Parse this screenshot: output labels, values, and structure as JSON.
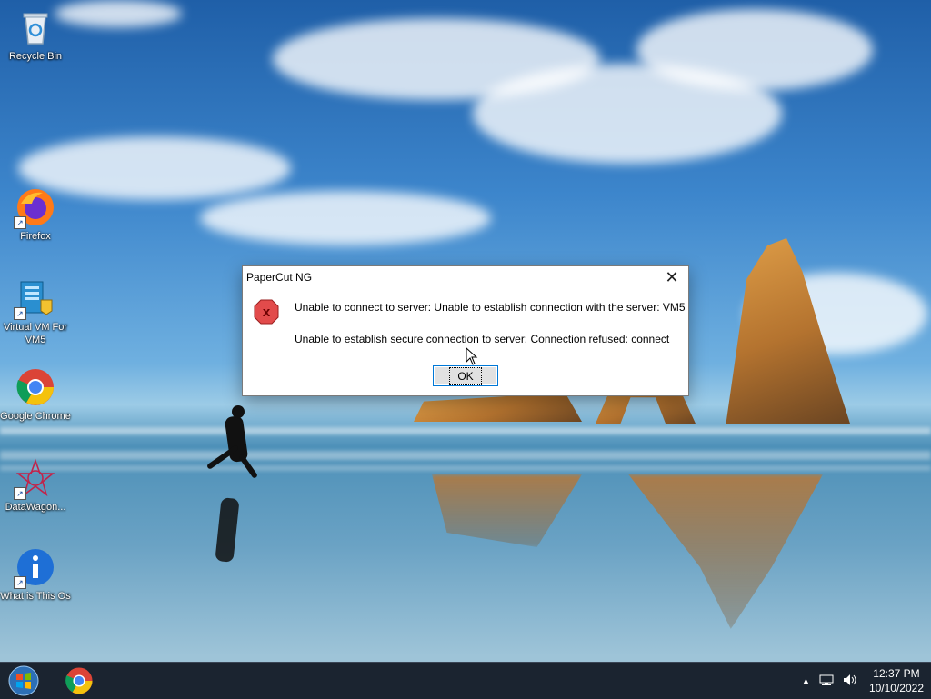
{
  "desktop": {
    "icons": [
      {
        "label": "Recycle Bin",
        "icon": "recycle-bin-icon"
      },
      {
        "label": "Firefox",
        "icon": "firefox-icon"
      },
      {
        "label": "Virtual VM For VM5",
        "icon": "virtual-vm-icon"
      },
      {
        "label": "Google Chrome",
        "icon": "chrome-icon"
      },
      {
        "label": "DataWagon...",
        "icon": "datawagon-icon"
      },
      {
        "label": "What is This Os",
        "icon": "info-icon"
      }
    ]
  },
  "dialog": {
    "title": "PaperCut NG",
    "close_symbol": "✕",
    "icon": "error-icon",
    "message_line1": "Unable to connect to server: Unable to establish connection with the server: VM5",
    "message_line2": "Unable to establish secure connection to server: Connection refused: connect",
    "ok_label": "OK"
  },
  "taskbar": {
    "start_icon": "windows-start-icon",
    "pinned": [
      {
        "name": "Google Chrome",
        "icon": "chrome-icon"
      }
    ],
    "tray": {
      "overflow_symbol": "▲",
      "network_icon": "network-icon",
      "volume_icon": "volume-icon",
      "time": "12:37 PM",
      "date": "10/10/2022"
    }
  },
  "colors": {
    "taskbar_bg": "#1b2430",
    "dialog_focus_border": "#0078d7",
    "error_red": "#d42a2a"
  }
}
